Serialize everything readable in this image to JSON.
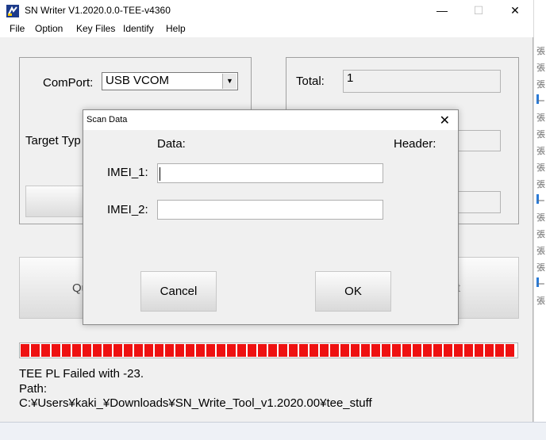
{
  "window": {
    "title": "SN Writer V1.2020.0.0-TEE-v4360",
    "minimize_glyph": "—",
    "maximize_glyph": "☐",
    "close_glyph": "✕"
  },
  "menu": [
    "File",
    "Option",
    "Key Files",
    "Identify",
    "Help"
  ],
  "main": {
    "comport_label": "ComPort:",
    "comport_value": "USB VCOM",
    "target_type_label": "Target Typ",
    "total_label": "Total:",
    "total_value": "1",
    "quit_button_partial": "Qu",
    "start_button_partial": "rt"
  },
  "progress": {
    "fraction": 1.0,
    "color": "#ee1111"
  },
  "status": {
    "line1": "TEE PL Failed with -23.",
    "line2": " Path:",
    "line3": "C:¥Users¥kaki_¥Downloads¥SN_Write_Tool_v1.2020.00¥tee_stuff"
  },
  "dialog": {
    "title": "Scan Data",
    "close_glyph": "✕",
    "data_label": "Data:",
    "header_label": "Header:",
    "imei1_label": "IMEI_1:",
    "imei1_value": "",
    "imei2_label": "IMEI_2:",
    "imei2_value": "",
    "cancel_label": "Cancel",
    "ok_label": "OK"
  },
  "background_glyphs": [
    "張",
    "張",
    "張",
    "ー",
    "張",
    "張",
    "張",
    "張",
    "張",
    "ー",
    "張",
    "張",
    "張",
    "張",
    "ー",
    "張"
  ]
}
